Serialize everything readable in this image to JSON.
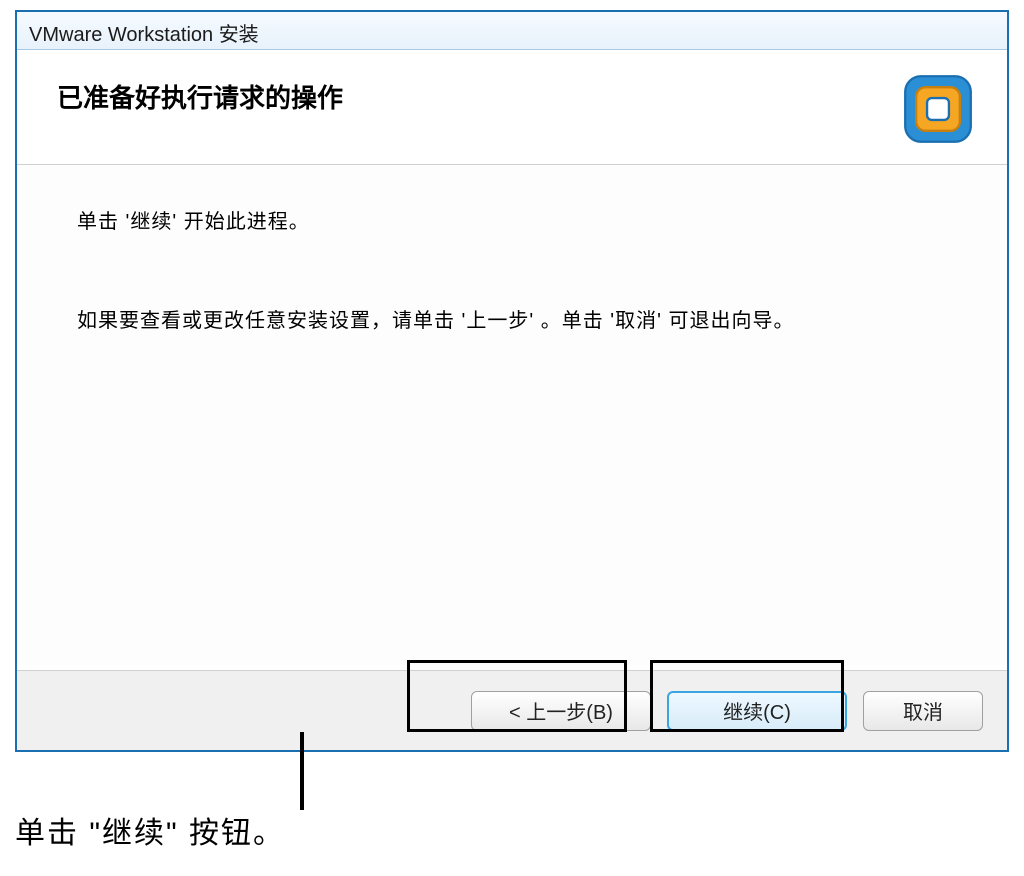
{
  "window": {
    "title": "VMware Workstation 安装"
  },
  "header": {
    "title": "已准备好执行请求的操作"
  },
  "content": {
    "line1": "单击 '继续' 开始此进程。",
    "line2": "如果要查看或更改任意安装设置，请单击 '上一步' 。单击 '取消' 可退出向导。"
  },
  "buttons": {
    "back": "< 上一步(B)",
    "continue": "继续(C)",
    "cancel": "取消"
  },
  "caption": "单击 \"继续\" 按钮。"
}
